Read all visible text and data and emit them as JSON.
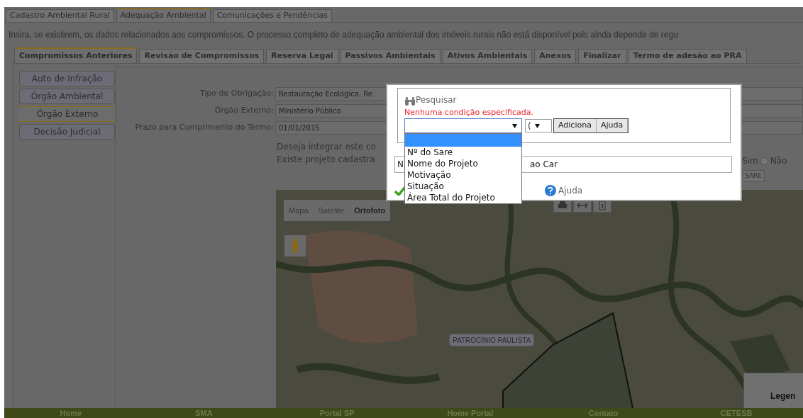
{
  "top_tabs": [
    {
      "label": "Cadastro Ambiental Rural",
      "selected": false
    },
    {
      "label": "Adequação Ambiental",
      "selected": true
    },
    {
      "label": "Comunicações e Pendências",
      "selected": false
    }
  ],
  "info_text": "Insira, se existirem, os dados relacionados aos compromissos. O processo completo de adequação ambiental dos imóveis rurais não está disponível pois ainda depende de regu",
  "sub_tabs": [
    {
      "label": "Compromissos Anteriores",
      "selected": true
    },
    {
      "label": "Revisão de Compromissos",
      "selected": false
    },
    {
      "label": "Reserva Legal",
      "selected": false
    },
    {
      "label": "Passivos Ambientais",
      "selected": false
    },
    {
      "label": "Ativos Ambientais",
      "selected": false
    },
    {
      "label": "Anexos",
      "selected": false
    },
    {
      "label": "Finalizar",
      "selected": false
    },
    {
      "label": "Termo de adesão ao PRA",
      "selected": false
    }
  ],
  "side_tabs": [
    {
      "label": "Auto de Infração",
      "selected": false
    },
    {
      "label": "Órgão Ambiental",
      "selected": false
    },
    {
      "label": "Órgão Externo",
      "selected": true
    },
    {
      "label": "Decisão Judicial",
      "selected": false
    }
  ],
  "form": {
    "fields": [
      {
        "label": "Tipo de Obrigação:",
        "value": "Restauração Ecológica, Re"
      },
      {
        "label": "Órgão Externo:",
        "value": "Ministério Público"
      },
      {
        "label": "Prazo para Cumprimento do Termo:",
        "value": "01/01/2015"
      }
    ],
    "integrate_question": "Deseja integrar este co",
    "project_question": "Existe projeto cadastra",
    "yes_label": "Sim",
    "no_option": {
      "label": "Não",
      "selected": false
    },
    "sare_button": "SARE"
  },
  "map": {
    "type_buttons": [
      {
        "label": "Mapa",
        "selected": false
      },
      {
        "label": "Satélite",
        "selected": false
      },
      {
        "label": "Ortofoto",
        "selected": true
      }
    ],
    "place_label": "PATROCÍNIO PAULISTA",
    "legend_title": "Legen"
  },
  "dialog": {
    "title": "Pesquisar",
    "message": "Nenhuma condição especificada.",
    "field_select": {
      "expanded": true,
      "blank_option_selected": true,
      "options": [
        {
          "label": "Nº do Sare"
        },
        {
          "label": "Nome do Projeto"
        },
        {
          "label": "Motivação"
        },
        {
          "label": "Situação"
        },
        {
          "label": "Área Total do Projeto"
        }
      ]
    },
    "paren_select": "(",
    "buttons": [
      "Adiciona",
      "Ajuda"
    ],
    "name_field": {
      "value_start": "N",
      "value_end": "ao Car"
    },
    "help_link": "Ajuda"
  },
  "footer_links": [
    "Home",
    "SMA",
    "Portal SP",
    "Home Portal",
    "Contato",
    "CETESB"
  ]
}
